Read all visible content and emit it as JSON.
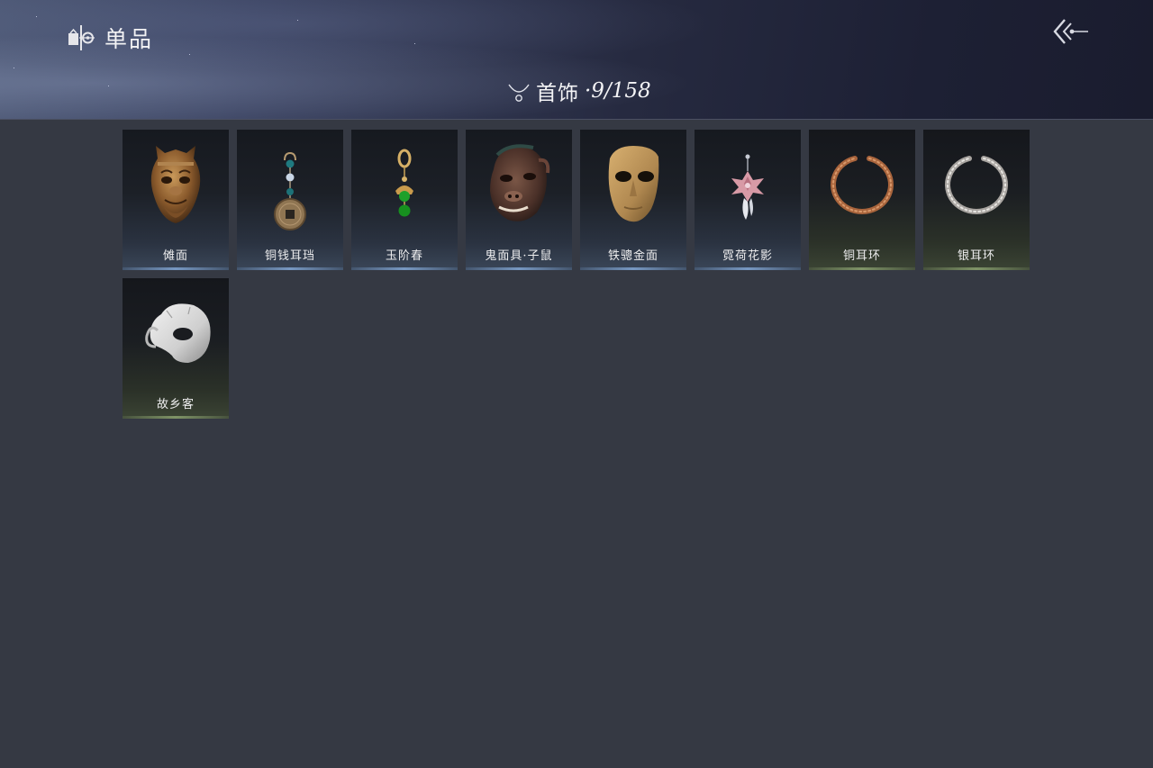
{
  "header": {
    "title": "单品",
    "title_icon": "wardrobe-icon",
    "back_icon": "double-chevron-left-icon"
  },
  "category": {
    "icon": "necklace-icon",
    "name": "首饰",
    "count": "·9/158"
  },
  "items": [
    {
      "name": "傩面",
      "icon": "bronze-beast-mask",
      "rarity": "blue"
    },
    {
      "name": "铜钱耳珰",
      "icon": "coin-earring",
      "rarity": "blue"
    },
    {
      "name": "玉阶春",
      "icon": "jade-bead-earring",
      "rarity": "blue"
    },
    {
      "name": "鬼面具·子鼠",
      "icon": "rat-demon-mask",
      "rarity": "blue"
    },
    {
      "name": "铁骢金面",
      "icon": "gold-face-mask",
      "rarity": "blue"
    },
    {
      "name": "霓荷花影",
      "icon": "lotus-pendant",
      "rarity": "blue"
    },
    {
      "name": "铜耳环",
      "icon": "copper-hoop-earring",
      "rarity": "green"
    },
    {
      "name": "银耳环",
      "icon": "silver-hoop-earring",
      "rarity": "green"
    },
    {
      "name": "故乡客",
      "icon": "white-half-mask",
      "rarity": "green"
    }
  ],
  "colors": {
    "background": "#353943",
    "header_dark": "#1d2034",
    "rarity_blue": "#8cb4e6",
    "rarity_green": "#96af78"
  }
}
